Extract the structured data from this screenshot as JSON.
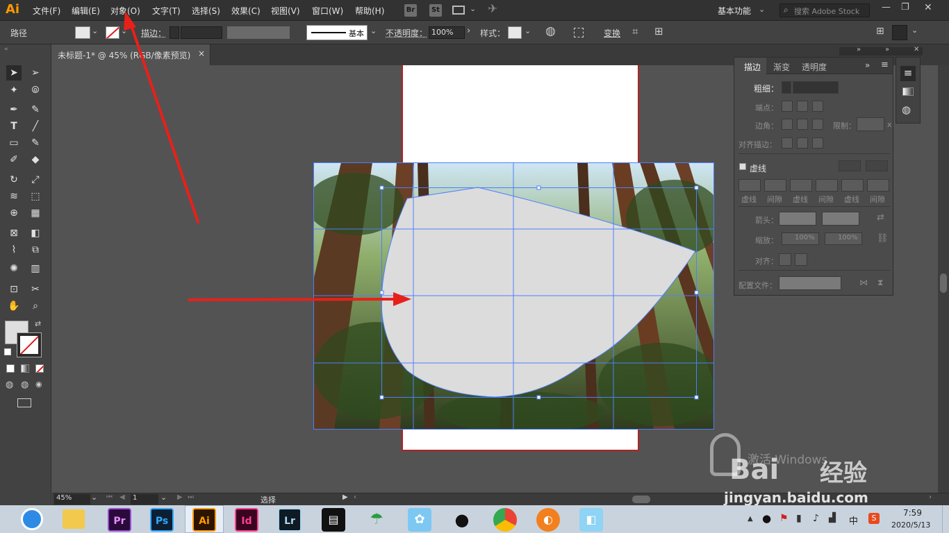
{
  "app": {
    "logo": "Ai"
  },
  "menu": [
    "文件(F)",
    "编辑(E)",
    "对象(O)",
    "文字(T)",
    "选择(S)",
    "效果(C)",
    "视图(V)",
    "窗口(W)",
    "帮助(H)"
  ],
  "menubar_right": {
    "bridge": "Br",
    "stock": "St",
    "workspace": "基本功能",
    "search_placeholder": "搜索 Adobe Stock"
  },
  "control_bar": {
    "selection_type": "路径",
    "stroke_label": "描边：",
    "brush_label": "基本",
    "opacity_label": "不透明度：",
    "opacity_value": "100%",
    "style_label": "样式：",
    "transform_label": "变换"
  },
  "document_tab": {
    "title": "未标题-1* @ 45% (RGB/像素预览)",
    "close": "×"
  },
  "stroke_panel": {
    "tabs": [
      "描边",
      "渐变",
      "透明度"
    ],
    "weight_label": "粗细：",
    "cap_label": "端点：",
    "corner_label": "边角：",
    "limit_label": "限制：",
    "limit_unit": "x",
    "align_label": "对齐描边：",
    "dashed_label": "虚线",
    "dash_labels": [
      "虚线",
      "间隙",
      "虚线",
      "间隙",
      "虚线",
      "间隙"
    ],
    "arrow_label": "箭头：",
    "scale_label": "缩放：",
    "scale_values": [
      "100%",
      "100%"
    ],
    "align_arrows_label": "对齐：",
    "profile_label": "配置文件："
  },
  "status_bar": {
    "zoom": "45%",
    "artboard": "1",
    "tool": "选择"
  },
  "taskbar": {
    "apps": [
      "Pr",
      "Ps",
      "Ai",
      "Id",
      "Lr"
    ],
    "tray_ime": "中",
    "time": "7:59",
    "date": "2020/5/13"
  },
  "watermark": {
    "activate": "激活 Windows",
    "brand": "Bai",
    "brand2": "经验",
    "url": "jingyan.baidu.com"
  },
  "colors": {
    "accent": "#ff9a00",
    "annotation_red": "#e8201a",
    "selection_blue": "#4d7fff"
  }
}
